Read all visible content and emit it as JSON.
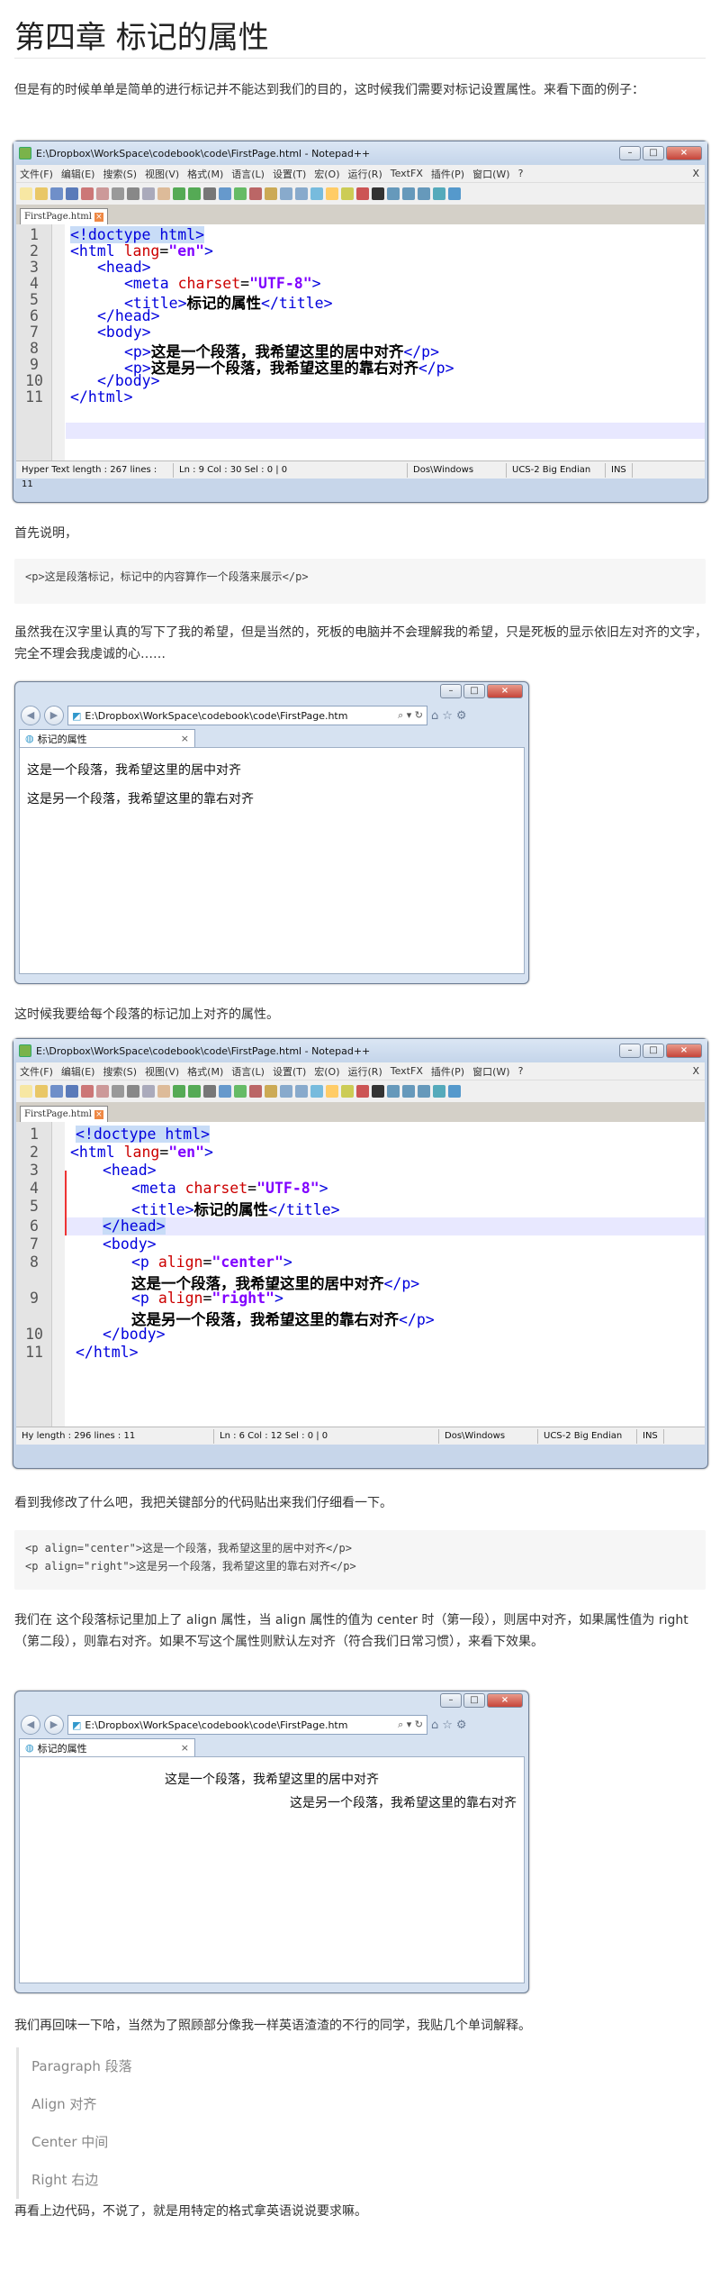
{
  "heading": "第四章 标记的属性",
  "intro": "但是有的时候单单是简单的进行标记并不能达到我们的目的，这时候我们需要对标记设置属性。来看下面的例子：",
  "npp1": {
    "title": "E:\\Dropbox\\WorkSpace\\codebook\\code\\FirstPage.html - Notepad++",
    "menu": [
      "文件(F)",
      "编辑(E)",
      "搜索(S)",
      "视图(V)",
      "格式(M)",
      "语言(L)",
      "设置(T)",
      "宏(O)",
      "运行(R)",
      "TextFX",
      "插件(P)",
      "窗口(W)",
      "?"
    ],
    "menu_close": "X",
    "tab": "FirstPage.html",
    "lines": [
      "1",
      "2",
      "3",
      "4",
      "5",
      "6",
      "7",
      "8",
      "9",
      "10",
      "11"
    ],
    "code": {
      "l1": "<!doctype html>",
      "l2a": "<html ",
      "l2b": "lang",
      "l2c": "=",
      "l2d": "\"en\"",
      "l2e": ">",
      "l3": "<head>",
      "l4a": "<meta ",
      "l4b": "charset",
      "l4c": "=",
      "l4d": "\"UTF-8\"",
      "l4e": ">",
      "l5a": "<title>",
      "l5b": "标记的属性",
      "l5c": "</title>",
      "l6": "</head>",
      "l7": "<body>",
      "l8a": "<p>",
      "l8b": "这是一个段落，我希望这里的居中对齐",
      "l8c": "</p>",
      "l9a": "<p>",
      "l9b": "这是另一个段落，我希望这里的靠右对齐",
      "l9c": "</p>",
      "l10": "</body>",
      "l11": "</html>"
    },
    "status": [
      "Hyper Text length : 267    lines : 11",
      "Ln : 9    Col : 30    Sel : 0 | 0",
      "Dos\\Windows",
      "UCS-2 Big Endian",
      "INS"
    ]
  },
  "explain_label": "首先说明，",
  "code1": "<p>这是段落标记，标记中的内容算作一个段落来展示</p>",
  "para2": "虽然我在汉字里认真的写下了我的希望，但是当然的，死板的电脑并不会理解我的希望，只是死板的显示依旧左对齐的文字，完全不理会我虔诚的心……",
  "ie1": {
    "address": "E:\\Dropbox\\WorkSpace\\codebook\\code\\FirstPage.htm",
    "tab": "标记的属性",
    "line1": "这是一个段落，我希望这里的居中对齐",
    "line2": "这是另一个段落，我希望这里的靠右对齐"
  },
  "para3": "这时候我要给每个段落的标记加上对齐的属性。",
  "npp2": {
    "title": "E:\\Dropbox\\WorkSpace\\codebook\\code\\FirstPage.html - Notepad++",
    "tab": "FirstPage.html",
    "lines": [
      "1",
      "2",
      "3",
      "4",
      "5",
      "6",
      "7",
      "8",
      "9",
      "10",
      "11"
    ],
    "code": {
      "l8a": "<p ",
      "l8b": "align",
      "l8c": "=",
      "l8d": "\"center\"",
      "l8e": ">",
      "l8f": "这是一个段落，我希望这里的居中对齐",
      "l8g": "</p>",
      "l9a": "<p ",
      "l9b": "align",
      "l9c": "=",
      "l9d": "\"right\"",
      "l9e": ">",
      "l9f": "这是另一个段落，我希望这里的靠右对齐",
      "l9g": "</p>"
    },
    "status": [
      "Hy length : 296    lines : 11",
      "Ln : 6    Col : 12    Sel : 0 | 0",
      "Dos\\Windows",
      "UCS-2 Big Endian",
      "INS"
    ]
  },
  "para4": "看到我修改了什么吧，我把关键部分的代码贴出来我们仔细看一下。",
  "code2": [
    "<p align=\"center\">这是一个段落，我希望这里的居中对齐</p>",
    "<p align=\"right\">这是另一个段落，我希望这里的靠右对齐</p>"
  ],
  "para5": "我们在 这个段落标记里加上了 align 属性，当 align 属性的值为 center 时（第一段），则居中对齐，如果属性值为 right （第二段），则靠右对齐。如果不写这个属性则默认左对齐（符合我们日常习惯），来看下效果。",
  "ie2": {
    "address": "E:\\Dropbox\\WorkSpace\\codebook\\code\\FirstPage.htm",
    "tab": "标记的属性",
    "line1": "这是一个段落，我希望这里的居中对齐",
    "line2": "这是另一个段落，我希望这里的靠右对齐"
  },
  "para6": "我们再回味一下哈，当然为了照顾部分像我一样英语渣渣的不行的同学，我贴几个单词解释。",
  "glossary": [
    "Paragraph 段落",
    "Align 对齐",
    "Center 中间",
    "Right 右边"
  ],
  "para7": "再看上边代码，不说了，就是用特定的格式拿英语说说要求嘛。"
}
